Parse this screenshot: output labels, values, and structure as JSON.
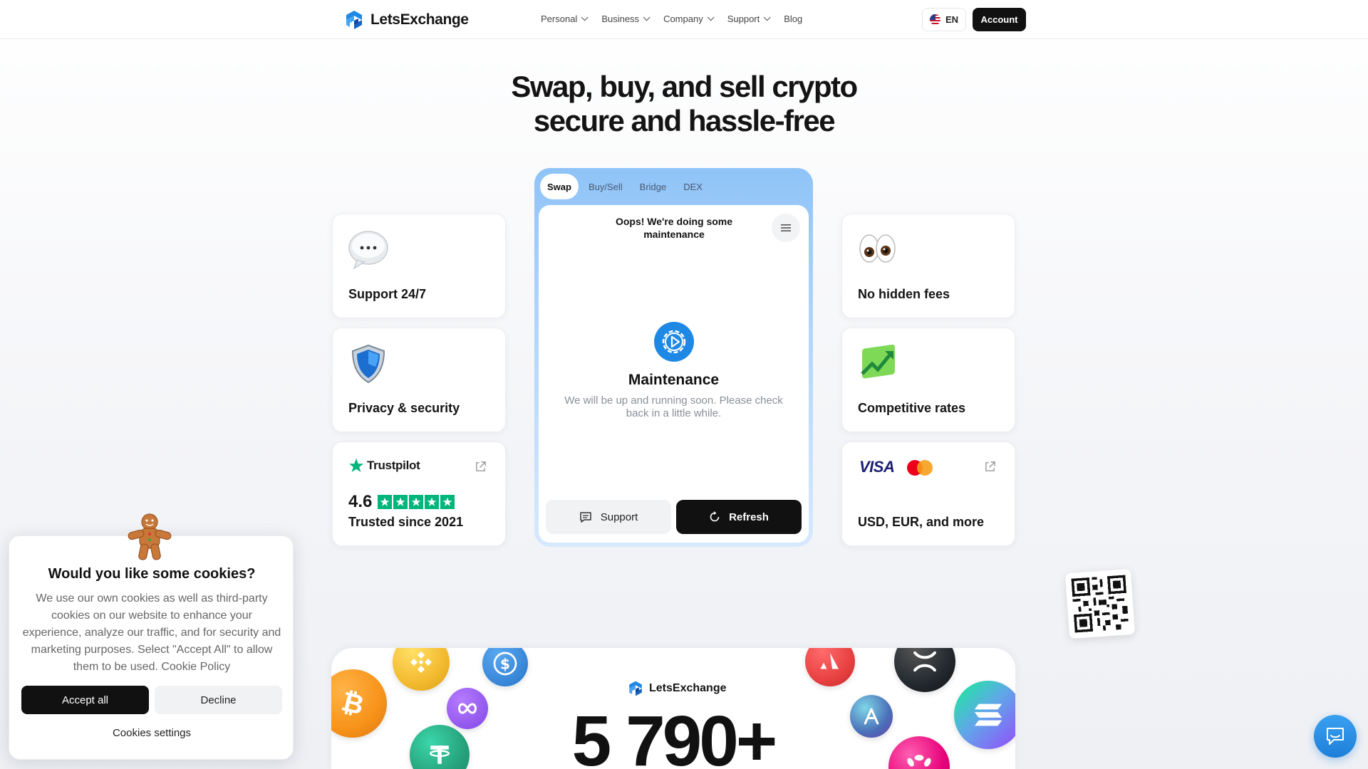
{
  "header": {
    "brand": "LetsExchange",
    "nav": [
      {
        "label": "Personal",
        "has_dropdown": true
      },
      {
        "label": "Business",
        "has_dropdown": true
      },
      {
        "label": "Company",
        "has_dropdown": true
      },
      {
        "label": "Support",
        "has_dropdown": true
      },
      {
        "label": "Blog",
        "has_dropdown": false
      }
    ],
    "language": "EN",
    "account_label": "Account"
  },
  "hero": {
    "line1": "Swap, buy, and sell crypto",
    "line2": "secure and hassle-free"
  },
  "features": {
    "support": {
      "title": "Support 24/7",
      "icon": "speech-bubble-icon"
    },
    "privacy": {
      "title": "Privacy & security",
      "icon": "shield-icon"
    },
    "fees": {
      "title": "No hidden fees",
      "icon": "eyes-icon"
    },
    "rates": {
      "title": "Competitive rates",
      "icon": "chart-up-icon"
    },
    "trustpilot": {
      "brand": "Trustpilot",
      "rating": "4.6",
      "stars": 5,
      "caption": "Trusted since 2021"
    },
    "payments": {
      "visa": "VISA",
      "caption": "USD, EUR, and more"
    }
  },
  "widget": {
    "tabs": [
      {
        "label": "Swap",
        "active": true
      },
      {
        "label": "Buy/Sell",
        "active": false
      },
      {
        "label": "Bridge",
        "active": false
      },
      {
        "label": "DEX",
        "active": false
      }
    ],
    "notice": "Oops! We're doing some maintenance",
    "maintenance_title": "Maintenance",
    "maintenance_text": "We will be up and running soon. Please check back in a little while.",
    "support_label": "Support",
    "refresh_label": "Refresh"
  },
  "cookie": {
    "title": "Would you like some cookies?",
    "text": "We use our own cookies as well as third-party cookies on our website to enhance your experience, analyze our traffic, and for security and marketing purposes. Select \"Accept All\" to allow them to be used. Cookie Policy",
    "accept_label": "Accept all",
    "decline_label": "Decline",
    "settings_label": "Cookies settings"
  },
  "bottom": {
    "brand": "LetsExchange",
    "count": "5 790+"
  },
  "colors": {
    "brand_blue": "#1e88e5",
    "dark": "#111111",
    "trustpilot_green": "#00b67a"
  }
}
